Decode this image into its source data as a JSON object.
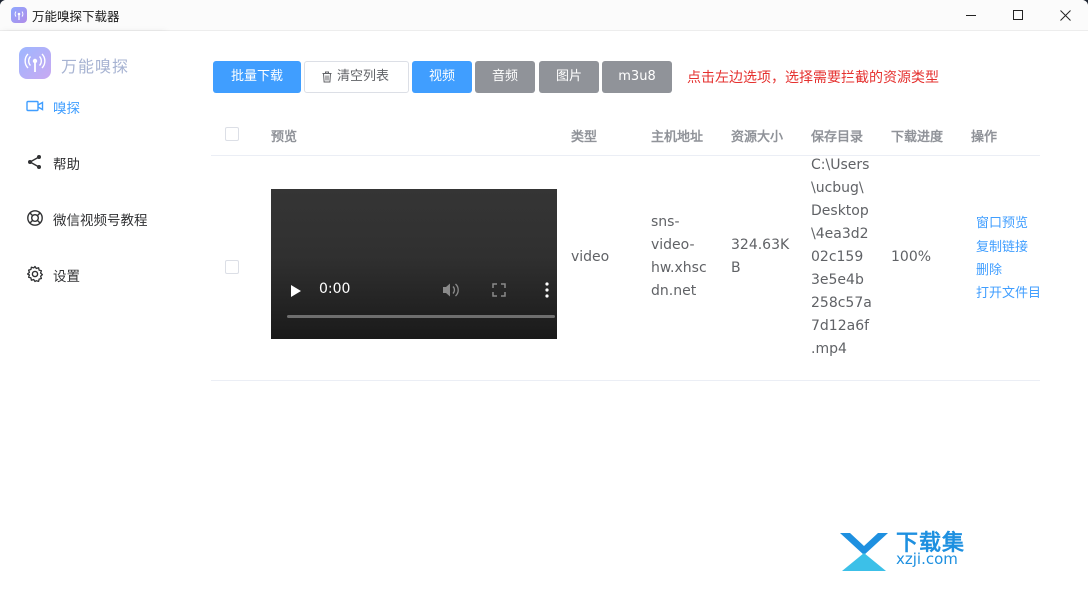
{
  "window": {
    "title": "万能嗅探下载器"
  },
  "sidebar": {
    "brand": "万能嗅探",
    "items": [
      {
        "label": "嗅探",
        "icon": "video-camera-icon",
        "active": true
      },
      {
        "label": "帮助",
        "icon": "share-icon",
        "active": false
      },
      {
        "label": "微信视频号教程",
        "icon": "lifebuoy-icon",
        "active": false
      },
      {
        "label": "设置",
        "icon": "gear-icon",
        "active": false
      }
    ]
  },
  "toolbar": {
    "batch_download": "批量下载",
    "clear_list": "清空列表",
    "filter_video": "视频",
    "filter_audio": "音频",
    "filter_image": "图片",
    "filter_m3u8": "m3u8",
    "hint": "点击左边选项，选择需要拦截的资源类型"
  },
  "table": {
    "headers": {
      "preview": "预览",
      "type": "类型",
      "host": "主机地址",
      "size": "资源大小",
      "save_dir": "保存目录",
      "progress": "下载进度",
      "actions": "操作"
    },
    "rows": [
      {
        "video_time": "0:00",
        "type": "video",
        "host_lines": [
          "sns-",
          "video-",
          "hw.xhsc",
          "dn.net"
        ],
        "size_lines": [
          "324.63K",
          "B"
        ],
        "path_lines": [
          "C:\\Users",
          "\\ucbug\\",
          "Desktop",
          "\\4ea3d2",
          "02c159",
          "3e5e4b",
          "258c57a",
          "7d12a6f",
          ".mp4"
        ],
        "progress": "100%",
        "actions": {
          "preview": "窗口预览",
          "copy": "复制链接",
          "delete": "删除",
          "open_folder": "打开文件目"
        }
      }
    ]
  },
  "watermark": {
    "title": "下载集",
    "site": "xzji.com"
  },
  "colors": {
    "accent": "#409eff",
    "info": "#909399",
    "hint": "#e5312f"
  }
}
